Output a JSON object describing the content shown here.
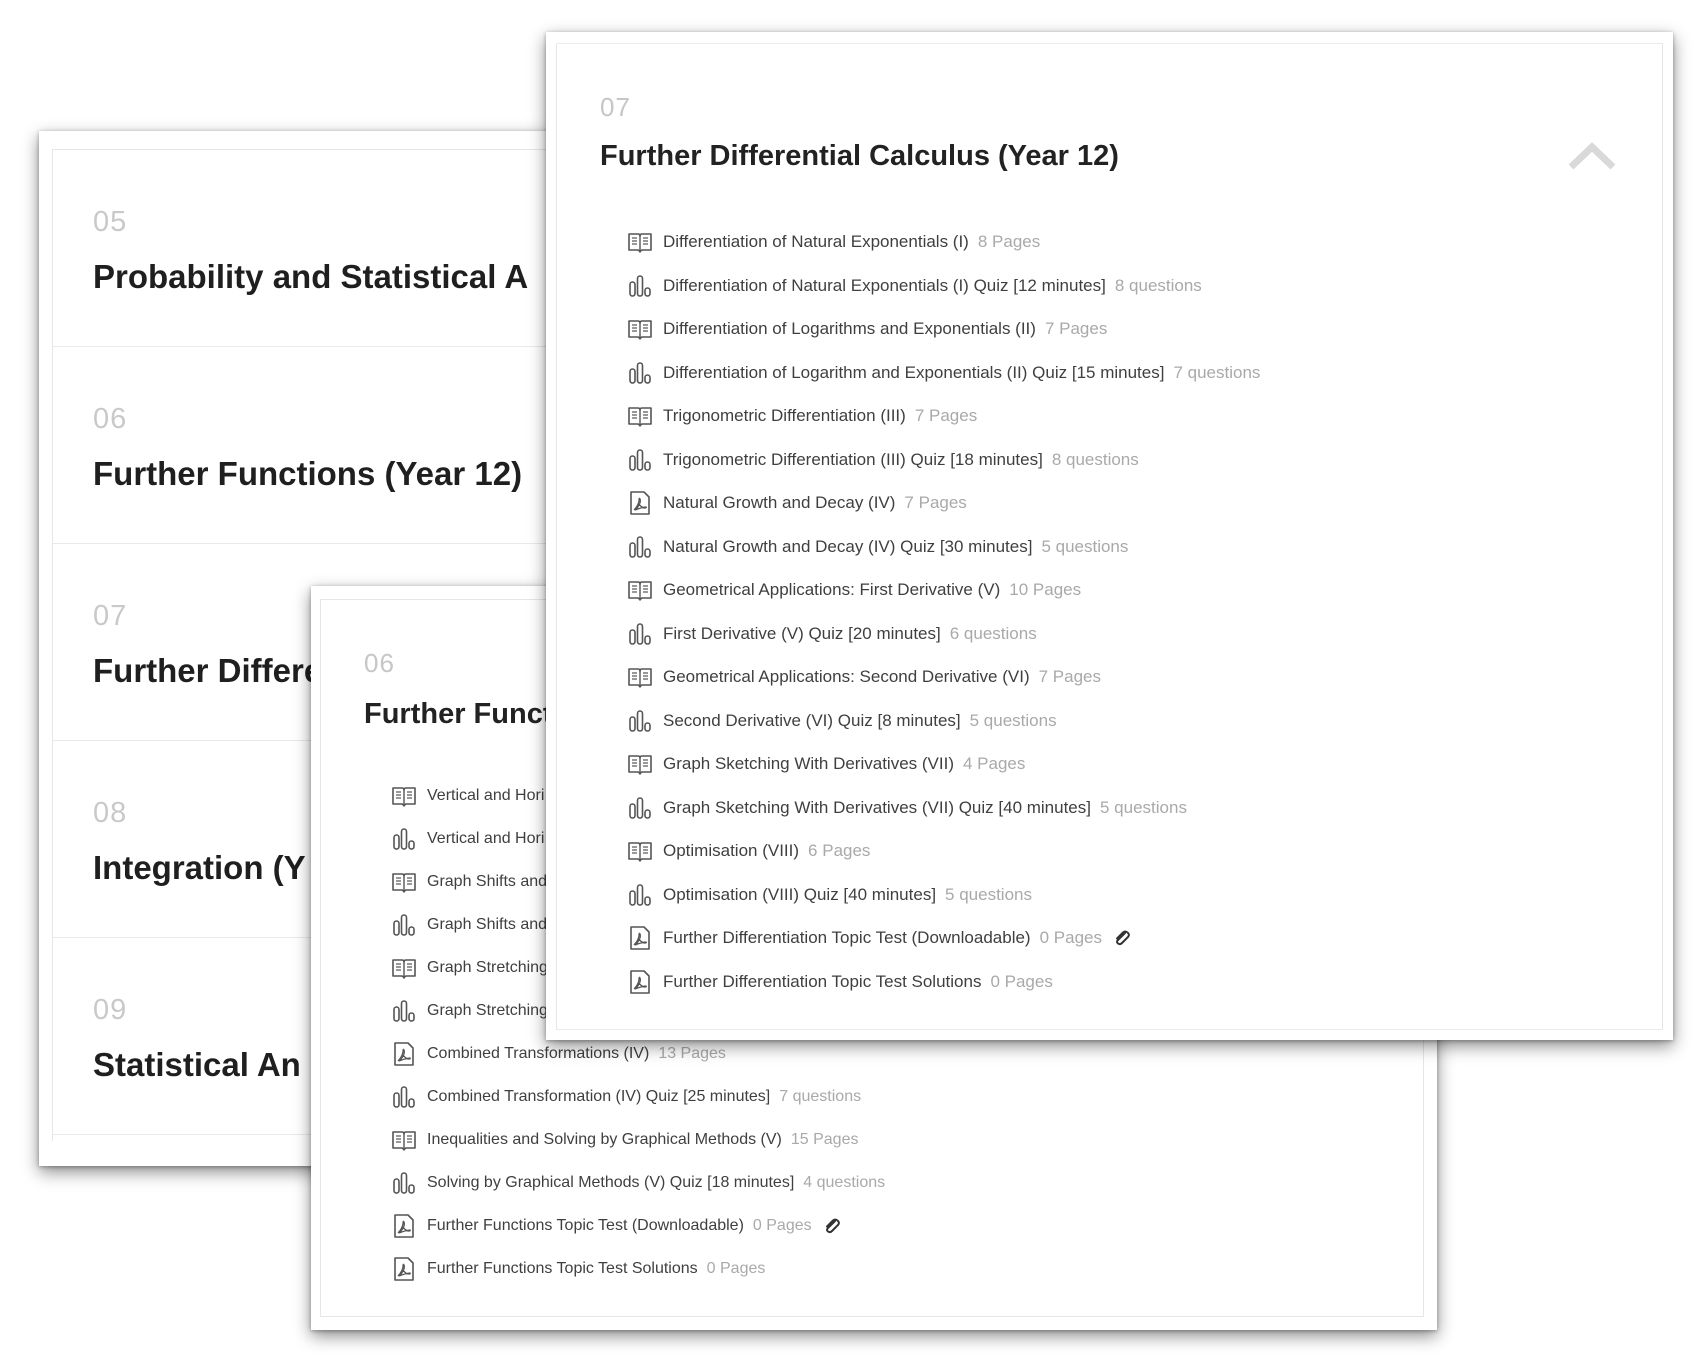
{
  "back_panel": {
    "sections": [
      {
        "num": "05",
        "title": "Probability and Statistical A"
      },
      {
        "num": "06",
        "title": "Further Functions (Year 12)"
      },
      {
        "num": "07",
        "title": "Further Differe"
      },
      {
        "num": "08",
        "title": "Integration (Y"
      },
      {
        "num": "09",
        "title": "Statistical An"
      }
    ]
  },
  "middle_panel": {
    "num": "06",
    "title": "Further Funct",
    "lessons": [
      {
        "icon": "book-icon",
        "title": "Vertical and Hori",
        "meta": ""
      },
      {
        "icon": "quiz-icon",
        "title": "Vertical and Hori",
        "meta": ""
      },
      {
        "icon": "book-icon",
        "title": "Graph Shifts and",
        "meta": ""
      },
      {
        "icon": "quiz-icon",
        "title": "Graph Shifts and",
        "meta": ""
      },
      {
        "icon": "book-icon",
        "title": "Graph Stretching",
        "meta": ""
      },
      {
        "icon": "quiz-icon",
        "title": "Graph Stretching",
        "meta": ""
      },
      {
        "icon": "pdf-icon",
        "title": "Combined Transformations (IV)",
        "meta": "13 Pages"
      },
      {
        "icon": "quiz-icon",
        "title": "Combined Transformation (IV) Quiz [25 minutes]",
        "meta": "7 questions"
      },
      {
        "icon": "book-icon",
        "title": "Inequalities and Solving by Graphical Methods (V)",
        "meta": "15 Pages"
      },
      {
        "icon": "quiz-icon",
        "title": "Solving by Graphical Methods (V) Quiz [18 minutes]",
        "meta": "4 questions"
      },
      {
        "icon": "pdf-icon",
        "title": "Further Functions Topic Test (Downloadable)",
        "meta": "0 Pages",
        "attachment": true
      },
      {
        "icon": "pdf-icon",
        "title": "Further Functions Topic Test Solutions",
        "meta": "0 Pages"
      }
    ]
  },
  "front_panel": {
    "num": "07",
    "title": "Further Differential Calculus (Year 12)",
    "collapse_icon": "chevron-up-icon",
    "lessons": [
      {
        "icon": "book-icon",
        "title": "Differentiation of Natural Exponentials (I)",
        "meta": "8 Pages"
      },
      {
        "icon": "quiz-icon",
        "title": "Differentiation of Natural Exponentials (I) Quiz [12 minutes]",
        "meta": "8 questions"
      },
      {
        "icon": "book-icon",
        "title": "Differentiation of Logarithms and Exponentials (II)",
        "meta": "7 Pages"
      },
      {
        "icon": "quiz-icon",
        "title": "Differentiation of Logarithm and Exponentials (II) Quiz [15 minutes]",
        "meta": "7 questions"
      },
      {
        "icon": "book-icon",
        "title": "Trigonometric Differentiation (III)",
        "meta": "7 Pages"
      },
      {
        "icon": "quiz-icon",
        "title": "Trigonometric Differentiation (III) Quiz [18 minutes]",
        "meta": "8 questions"
      },
      {
        "icon": "pdf-icon",
        "title": "Natural Growth and Decay (IV)",
        "meta": "7 Pages"
      },
      {
        "icon": "quiz-icon",
        "title": "Natural Growth and Decay (IV) Quiz [30 minutes]",
        "meta": "5 questions"
      },
      {
        "icon": "book-icon",
        "title": "Geometrical Applications: First Derivative (V)",
        "meta": "10 Pages"
      },
      {
        "icon": "quiz-icon",
        "title": "First Derivative (V) Quiz [20 minutes]",
        "meta": "6 questions"
      },
      {
        "icon": "book-icon",
        "title": "Geometrical Applications: Second Derivative (VI)",
        "meta": "7 Pages"
      },
      {
        "icon": "quiz-icon",
        "title": "Second Derivative (VI) Quiz [8 minutes]",
        "meta": "5 questions"
      },
      {
        "icon": "book-icon",
        "title": "Graph Sketching With Derivatives (VII)",
        "meta": "4 Pages"
      },
      {
        "icon": "quiz-icon",
        "title": "Graph Sketching With Derivatives (VII) Quiz [40 minutes]",
        "meta": "5 questions"
      },
      {
        "icon": "book-icon",
        "title": "Optimisation (VIII)",
        "meta": "6 Pages"
      },
      {
        "icon": "quiz-icon",
        "title": "Optimisation (VIII) Quiz [40 minutes]",
        "meta": "5 questions"
      },
      {
        "icon": "pdf-icon",
        "title": "Further Differentiation Topic Test (Downloadable)",
        "meta": "0 Pages",
        "attachment": true
      },
      {
        "icon": "pdf-icon",
        "title": "Further Differentiation Topic Test Solutions",
        "meta": "0 Pages"
      }
    ]
  }
}
